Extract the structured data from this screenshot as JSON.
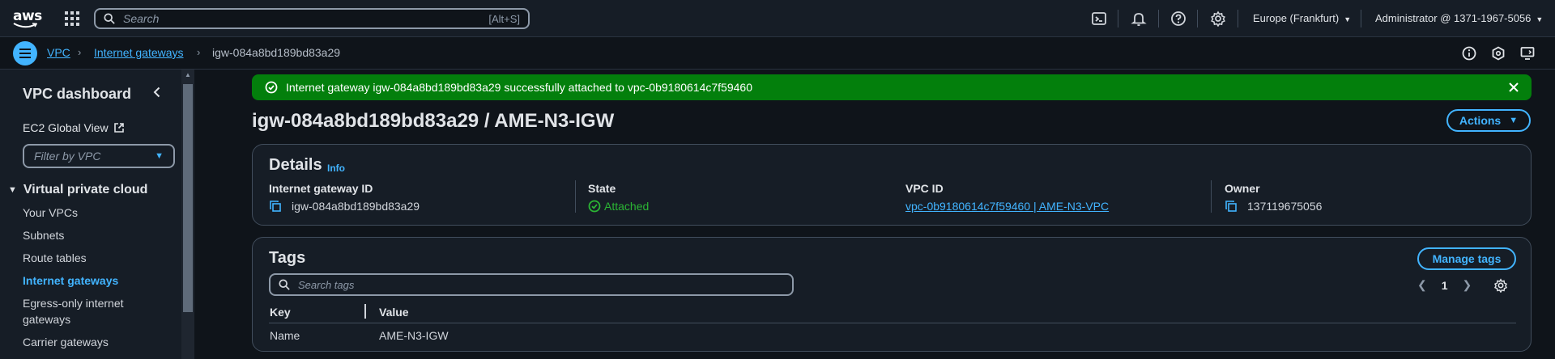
{
  "topbar": {
    "logo_text": "aws",
    "search_placeholder": "Search",
    "search_shortcut": "[Alt+S]",
    "region": "Europe (Frankfurt)",
    "account": "Administrator @ 1371-1967-5056",
    "icons": [
      "apps-grid-icon",
      "cloudshell-icon",
      "bell-icon",
      "help-icon",
      "gear-icon"
    ]
  },
  "breadcrumb": {
    "items": [
      "VPC",
      "Internet gateways",
      "igw-084a8bd189bd83a29"
    ],
    "right_icons": [
      "info-icon",
      "feedback-icon",
      "display-icon"
    ]
  },
  "sidebar": {
    "title": "VPC dashboard",
    "ec2_global_view": "EC2 Global View",
    "filter_placeholder": "Filter by VPC",
    "section": "Virtual private cloud",
    "items": [
      {
        "label": "Your VPCs",
        "active": false
      },
      {
        "label": "Subnets",
        "active": false
      },
      {
        "label": "Route tables",
        "active": false
      },
      {
        "label": "Internet gateways",
        "active": true
      },
      {
        "label": "Egress-only internet gateways",
        "active": false
      },
      {
        "label": "Carrier gateways",
        "active": false
      }
    ]
  },
  "flash": {
    "message": "Internet gateway igw-084a8bd189bd83a29 successfully attached to vpc-0b9180614c7f59460",
    "color": "#037f0c"
  },
  "page": {
    "title": "igw-084a8bd189bd83a29 / AME-N3-IGW",
    "actions_label": "Actions"
  },
  "details": {
    "heading": "Details",
    "info_label": "Info",
    "fields": {
      "igw_id_label": "Internet gateway ID",
      "igw_id_value": "igw-084a8bd189bd83a29",
      "state_label": "State",
      "state_value": "Attached",
      "vpc_id_label": "VPC ID",
      "vpc_id_value": "vpc-0b9180614c7f59460 | AME-N3-VPC",
      "owner_label": "Owner",
      "owner_value": "137119675056"
    }
  },
  "tags": {
    "heading": "Tags",
    "manage_label": "Manage tags",
    "search_placeholder": "Search tags",
    "page_number": "1",
    "columns": [
      "Key",
      "Value"
    ],
    "rows": [
      {
        "key": "Name",
        "value": "AME-N3-IGW"
      }
    ]
  },
  "colors": {
    "accent": "#42b4ff",
    "success": "#2bb534",
    "background": "#0f141a"
  }
}
